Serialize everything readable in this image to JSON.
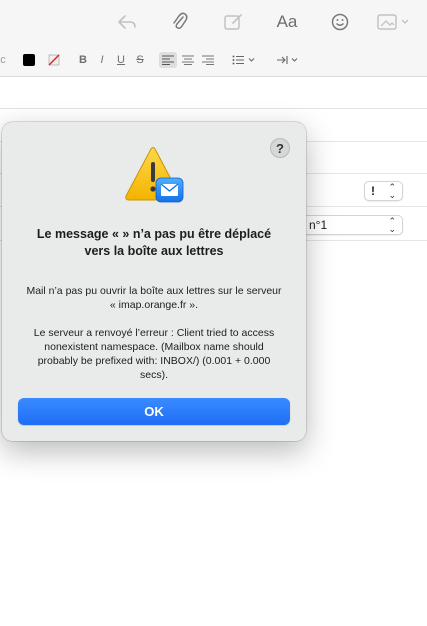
{
  "toolbar": {
    "items": [
      {
        "name": "reply-icon",
        "glyph": "↶"
      },
      {
        "name": "attachment-icon",
        "glyph": "📎"
      },
      {
        "name": "markup-icon",
        "glyph": "✎"
      },
      {
        "name": "font-format-icon",
        "glyph": "Aa"
      },
      {
        "name": "emoji-icon",
        "glyph": "☺"
      },
      {
        "name": "photo-browser-icon",
        "glyph": "▣"
      }
    ]
  },
  "format_bar": {
    "bold": "B",
    "italic": "I",
    "underline": "U",
    "strike": "S",
    "text_color": "#000000"
  },
  "header": {
    "priority_value": "!",
    "signature_value": "n°1"
  },
  "alert": {
    "title_line1": "Le message «  » n’a pas pu être déplacé",
    "title_line2": "vers la boîte aux lettres",
    "message_p1": "Mail n’a pas pu ouvrir la boîte aux lettres sur le serveur « imap.orange.fr ».",
    "message_p2": "Le serveur a renvoyé l’erreur : Client tried to access nonexistent namespace. (Mailbox name should probably be prefixed with: INBOX/) (0.001 + 0.000 secs).",
    "help_label": "?",
    "ok_label": "OK",
    "accent": "#1f6ef5"
  }
}
